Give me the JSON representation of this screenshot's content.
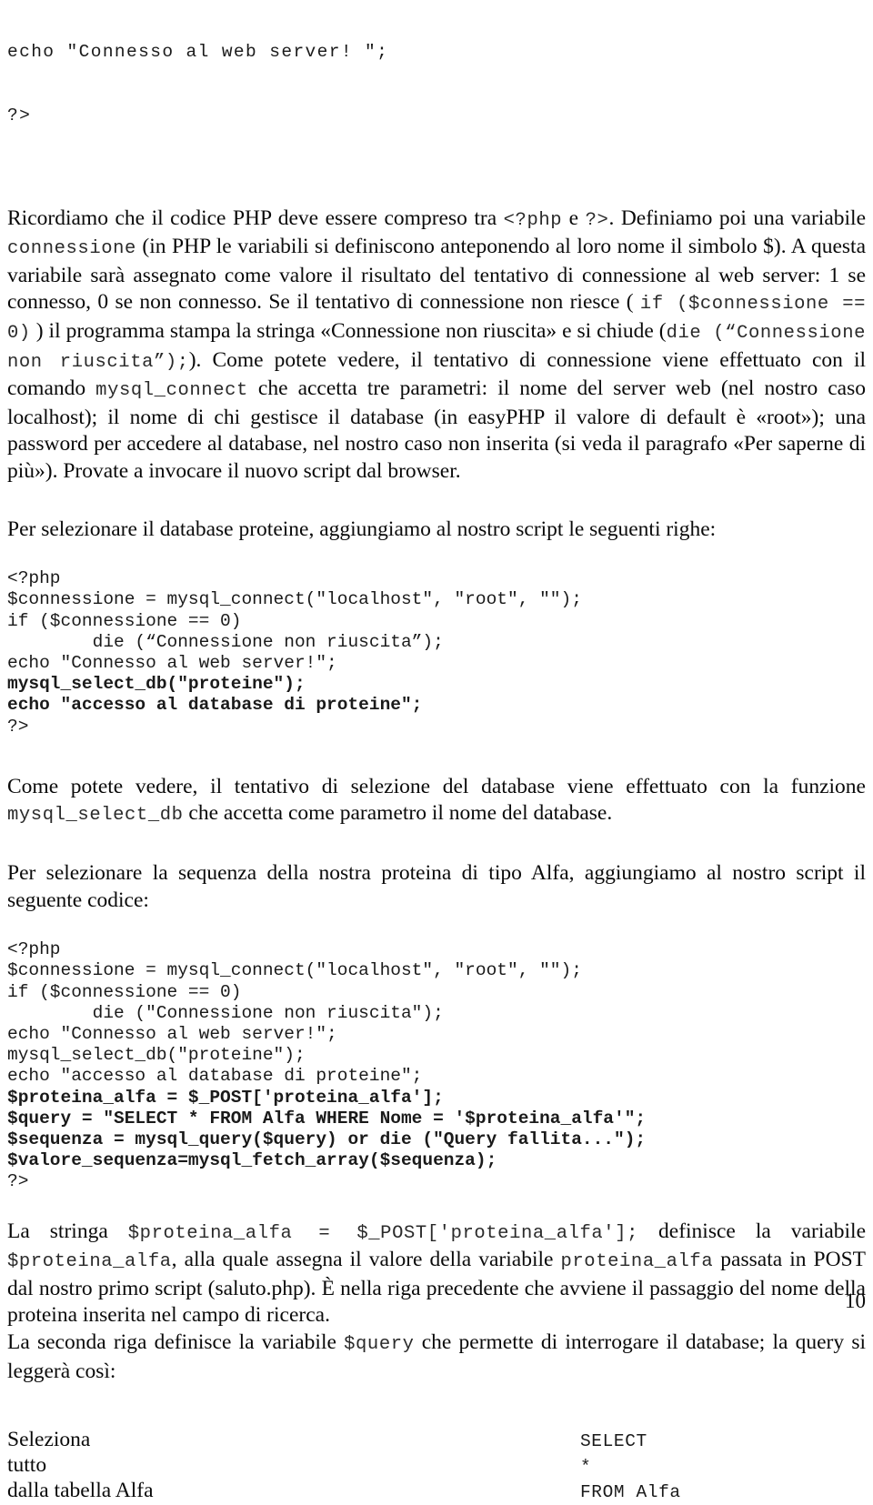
{
  "document": {
    "page_number": "10"
  },
  "top_code": {
    "lines": [
      "echo \"Connesso al web server! \";",
      "?>"
    ]
  },
  "paragraph_1": {
    "seg_1": "Ricordiamo che il codice PHP deve essere compreso tra ",
    "code_1": "<?php",
    "seg_2": " e ",
    "code_2": "?>",
    "seg_3": ". Definiamo poi una variabile ",
    "code_3": "connessione",
    "seg_4": " (in PHP le variabili si definiscono anteponendo al loro nome il simbolo $). A questa variabile sarà assegnato come valore il risultato del tentativo di connessione al web server: 1 se connesso, 0 se non connesso. Se il tentativo di connessione non riesce ( ",
    "code_4": "if ($connessione == 0)",
    "seg_5": " ) il programma stampa la stringa «Connessione non riuscita» e si chiude (",
    "code_5": "die (“Connessione non riuscita”);",
    "seg_6": "). Come potete vedere, il tentativo di connessione viene effettuato con il comando ",
    "code_6": "mysql_connect",
    "seg_7": " che accetta tre parametri: il nome del server web (nel nostro caso localhost); il nome di chi gestisce il database (in easyPHP il valore di default è «root»); una password per accedere al database, nel nostro caso non inserita (si veda il paragrafo «Per saperne di più»). Provate a invocare il nuovo script dal browser."
  },
  "paragraph_2": {
    "text": "Per selezionare il database proteine, aggiungiamo al nostro script le seguenti righe:"
  },
  "code_block_1": {
    "lines": [
      {
        "text": "<?php",
        "bold": false
      },
      {
        "text": "$connessione = mysql_connect(\"localhost\", \"root\", \"\");",
        "bold": false
      },
      {
        "text": "if ($connessione == 0)",
        "bold": false
      },
      {
        "text": "        die (“Connessione non riuscita”);",
        "bold": false
      },
      {
        "text": "echo \"Connesso al web server!\";",
        "bold": false
      },
      {
        "text": "mysql_select_db(\"proteine\");",
        "bold": true
      },
      {
        "text": "echo \"accesso al database di proteine\";",
        "bold": true
      },
      {
        "text": "?>",
        "bold": false
      }
    ]
  },
  "paragraph_3": {
    "seg_1": "Come potete vedere, il tentativo di selezione del database viene effettuato con la funzione ",
    "code_1": "mysql_select_db",
    "seg_2": " che accetta come parametro il nome del database."
  },
  "paragraph_4": {
    "text": "Per selezionare la sequenza della nostra proteina di tipo Alfa, aggiungiamo al nostro script il seguente codice:"
  },
  "code_block_2": {
    "lines": [
      {
        "text": "<?php",
        "bold": false
      },
      {
        "text": "$connessione = mysql_connect(\"localhost\", \"root\", \"\");",
        "bold": false
      },
      {
        "text": "if ($connessione == 0)",
        "bold": false
      },
      {
        "text": "        die (\"Connessione non riuscita\");",
        "bold": false
      },
      {
        "text": "echo \"Connesso al web server!\";",
        "bold": false
      },
      {
        "text": "mysql_select_db(\"proteine\");",
        "bold": false
      },
      {
        "text": "echo \"accesso al database di proteine\";",
        "bold": false
      },
      {
        "text": "$proteina_alfa = $_POST['proteina_alfa'];",
        "bold": true
      },
      {
        "text": "$query = \"SELECT * FROM Alfa WHERE Nome = '$proteina_alfa'\";",
        "bold": true
      },
      {
        "text": "$sequenza = mysql_query($query) or die (\"Query fallita...\");",
        "bold": true
      },
      {
        "text": "$valore_sequenza=mysql_fetch_array($sequenza);",
        "bold": true
      },
      {
        "text": "?>",
        "bold": false
      }
    ]
  },
  "paragraph_5": {
    "seg_1": "La stringa ",
    "code_1": "$proteina_alfa = $_POST['proteina_alfa'];",
    "seg_2": " definisce la variabile ",
    "code_2": "$proteina_alfa",
    "seg_3": ", alla quale assegna il valore della variabile ",
    "code_3": "proteina_alfa",
    "seg_4": " passata in POST dal nostro primo script (saluto.php). È nella riga precedente che avviene il passaggio del nome della proteina inserita nel campo di ricerca."
  },
  "paragraph_6": {
    "seg_1": "La seconda riga definisce la variabile ",
    "code_1": "$query",
    "seg_2": " che permette di interrogare il database; la query si leggerà così:"
  },
  "query_gloss": {
    "rows": [
      {
        "italian": "Seleziona",
        "sql": "SELECT"
      },
      {
        "italian": "tutto",
        "sql": "*"
      },
      {
        "italian": "dalla tabella Alfa",
        "sql": "FROM Alfa"
      }
    ]
  }
}
